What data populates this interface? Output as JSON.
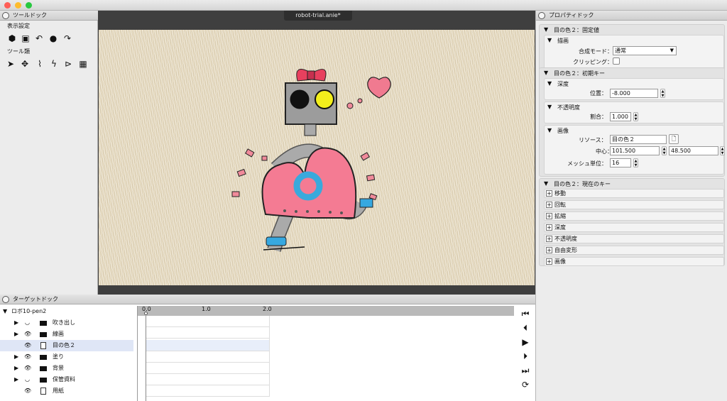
{
  "window": {
    "dot_colors": [
      "#fe5f57",
      "#febc2e",
      "#28c840"
    ]
  },
  "tool_dock": {
    "title": "ツールドック",
    "display_label": "表示設定",
    "tools_label": "ツール類"
  },
  "canvas": {
    "tab_title": "robot-trial.anie*",
    "bg_color": "#3f3f3f",
    "stage_color": "#e7dcc3"
  },
  "prop_dock": {
    "title": "プロパティドック",
    "fixed": {
      "title": "目の色２：固定値",
      "draw_title": "描画",
      "blend_label": "合成モード：",
      "blend_value": "通常",
      "clip_label": "クリッピング："
    },
    "initial": {
      "title": "目の色２：初期キー",
      "depth_title": "深度",
      "position_label": "位置：",
      "position_value": "-8.000",
      "opacity_title": "不透明度",
      "ratio_label": "割合：",
      "ratio_value": "1.000",
      "image_title": "画像",
      "resource_label": "リソース：",
      "resource_value": "目の色２",
      "center_label": "中心：",
      "center_x": "101.500",
      "center_y": "48.500",
      "mesh_label": "メッシュ単位：",
      "mesh_value": "16"
    },
    "current": {
      "title": "目の色２：現在のキー",
      "items": [
        "移動",
        "回転",
        "拡縮",
        "深度",
        "不透明度",
        "自由変形",
        "画像"
      ]
    }
  },
  "target_dock": {
    "title": "ターゲットドック",
    "root": "ロボ10-pen2",
    "rows": [
      {
        "label": "吹き出し",
        "type": "folder",
        "visible": false
      },
      {
        "label": "線画",
        "type": "folder",
        "visible": true
      },
      {
        "label": "目の色２",
        "type": "file",
        "visible": true
      },
      {
        "label": "塗り",
        "type": "folder",
        "visible": true
      },
      {
        "label": "背景",
        "type": "folder",
        "visible": true
      },
      {
        "label": "保管資料",
        "type": "folder",
        "visible": false
      },
      {
        "label": "用紙",
        "type": "file",
        "visible": true
      }
    ],
    "ruler": [
      "0.0",
      "1.0",
      "2.0"
    ]
  }
}
